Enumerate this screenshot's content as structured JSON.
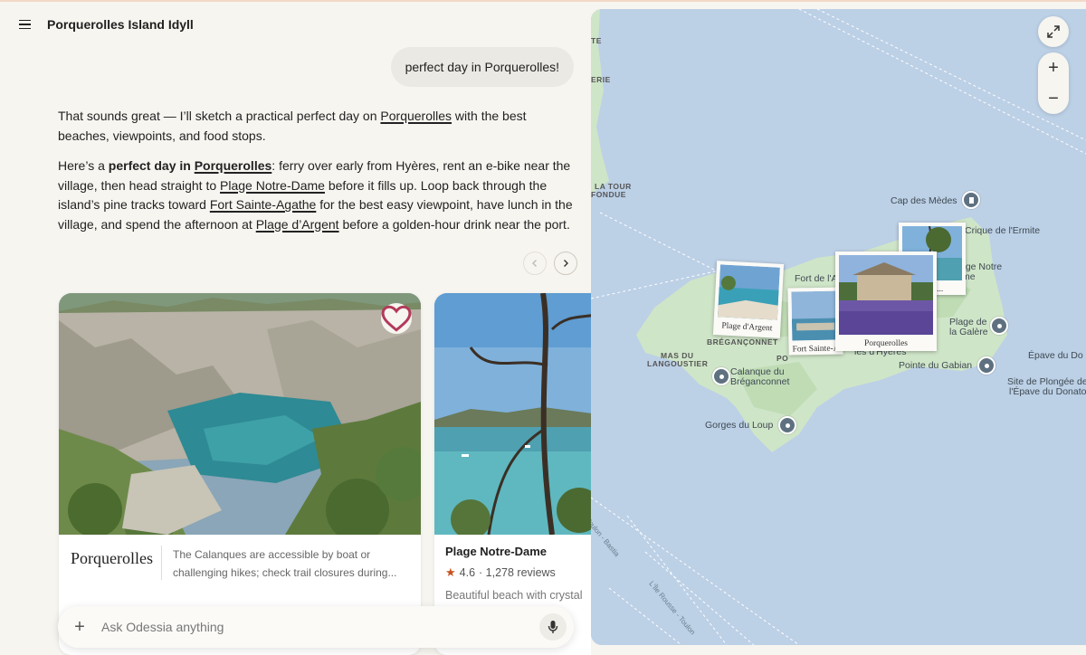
{
  "header": {
    "title": "Porquerolles Island Idyll"
  },
  "user_message": "perfect day in Porquerolles!",
  "reply": {
    "p1_a": "That sounds great — I’ll sketch a practical perfect day on ",
    "p1_link": "Porquerolles",
    "p1_b": " with the best beaches, viewpoints, and food stops.",
    "p2_a": "Here’s a ",
    "p2_bold": "perfect day in ",
    "p2_link1": "Porquerolles",
    "p2_b": ": ferry over early from Hyères, rent an e-bike near the village, then head straight to ",
    "p2_link2": "Plage Notre-Dame",
    "p2_c": " before it fills up. Loop back through the island’s pine tracks toward ",
    "p2_link3": "Fort Sainte-Agathe",
    "p2_d": " for the best easy viewpoint, have lunch in the village, and spend the afternoon at ",
    "p2_link4": "Plage d’Argent",
    "p2_e": " before a golden-hour drink near the port."
  },
  "cards": [
    {
      "brand": "Porquerolles",
      "description": "The Calanques are accessible by boat or challenging hikes; check trail closures during..."
    },
    {
      "name": "Plage Notre-Dame",
      "rating": "4.6",
      "reviews": "· 1,278 reviews",
      "description": "Beautiful beach with crystal"
    }
  ],
  "composer": {
    "placeholder": "Ask Odessia anything"
  },
  "map": {
    "labels": {
      "te": "TE",
      "erie": "ERIE",
      "la_tour": "LA TOUR",
      "fondue": "FONDUE",
      "cap_medes": "Cap des Mèdes",
      "crique": "Crique de l'Ermite",
      "age_notre": "age Notre",
      "me": "me",
      "fort_a": "Fort de l'A",
      "breganconnet": "BRÉGANÇONNET",
      "po": "PO",
      "mas_du": "MAS DU",
      "langoustier": "LANGOUSTIER",
      "calanque1": "Calanque du",
      "calanque2": "Bréganconnet",
      "plage_galere1": "Plage de",
      "plage_galere2": "la Galère",
      "pointe_gabian": "Pointe du Gabian",
      "epave": "Épave du Do",
      "site_plongee1": "Site de Plongée de",
      "site_plongee2": "l'Épave du Donato",
      "gorges": "Gorges du Loup",
      "hyeres": "les d'Hyères",
      "toulon_bastia": "Toulon - Bastia",
      "ile_rousse": "L'Île Rousse - Toulon"
    },
    "polaroids": {
      "argent": "Plage d'Argent",
      "agathe": "Fort Sainte-A...",
      "porquerolles": "Porquerolles",
      "notre": "re-D..."
    }
  },
  "colors": {
    "water": "#bcd0e6",
    "land": "#cfe5c8",
    "background": "#f7f5f0",
    "star": "#c8511f"
  }
}
